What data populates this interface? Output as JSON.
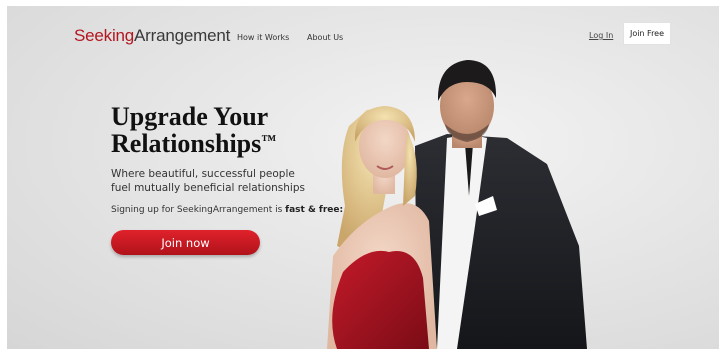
{
  "nav": {
    "logo": {
      "part1": "Seeking",
      "part2": "Arrangement"
    },
    "links": [
      "How it Works",
      "About Us"
    ],
    "login": "Log In",
    "join_free": "Join Free"
  },
  "hero": {
    "headline_line1": "Upgrade Your",
    "headline_line2": "Relationships",
    "trademark": "™",
    "sub_line1": "Where beautiful, successful people",
    "sub_line2": "fuel mutually beneficial relationships",
    "signup_prefix": "Signing up for SeekingArrangement is ",
    "signup_bold": "fast & free:",
    "cta": "Join now"
  },
  "colors": {
    "brand_red": "#b4161f",
    "cta_red": "#d01a23",
    "background": "#e6e6e6"
  }
}
